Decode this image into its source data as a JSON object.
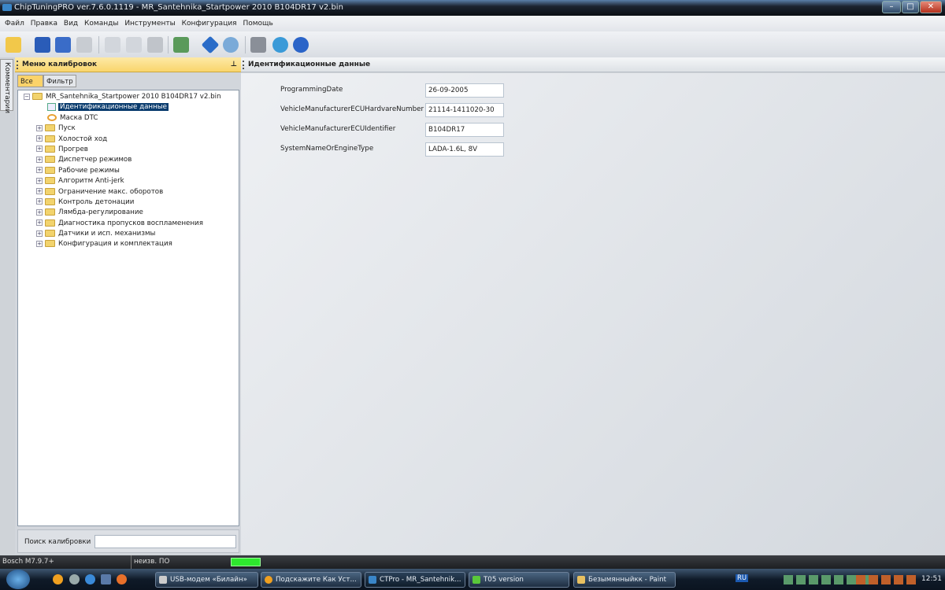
{
  "window": {
    "title": "ChipTuningPRO ver.7.6.0.1119 - MR_Santehnika_Startpower 2010 B104DR17 v2.bin",
    "min": "–",
    "max": "□",
    "close": "✕"
  },
  "menu": [
    "Файл",
    "Правка",
    "Вид",
    "Команды",
    "Инструменты",
    "Конфигурация",
    "Помощь"
  ],
  "side_tab": "Комментарии",
  "left_panel": {
    "title": "Меню калибровок",
    "pin": "ᵖ",
    "tabs": [
      "Все",
      "Фильтр"
    ],
    "root": "MR_Santehnika_Startpower 2010 B104DR17 v2.bin",
    "leaf_items": [
      "Идентификационные данные",
      "Маска DTC"
    ],
    "folders": [
      "Пуск",
      "Холостой ход",
      "Прогрев",
      "Диспетчер режимов",
      "Рабочие режимы",
      "Алгоритм Anti-jerk",
      "Ограничение макс. оборотов",
      "Контроль детонации",
      "Лямбда-регулирование",
      "Диагностика пропусков воспламенения",
      "Датчики и исп. механизмы",
      "Конфигурация и комплектация"
    ],
    "search_label": "Поиск калибровки",
    "search_value": ""
  },
  "right_panel": {
    "title": "Идентификационные данные",
    "fields": [
      {
        "label": "ProgrammingDate",
        "value": "26-09-2005"
      },
      {
        "label": "VehicleManufacturerECUHardvareNumber",
        "value": "21114-1411020-30"
      },
      {
        "label": "VehicleManufacturerECUIdentifier",
        "value": "B104DR17"
      },
      {
        "label": "SystemNameOrEngineType",
        "value": "LADA-1.6L, 8V"
      }
    ]
  },
  "status": {
    "ecu": "Bosch M7.9.7+",
    "software": "неизв. ПО",
    "indicator_color": "#2ee82e"
  },
  "taskbar": {
    "tasks": [
      "USB-модем «Билайн»",
      "Подскажите Как Уст...",
      "CTPro - MR_Santehnik...",
      "T05 version",
      "Безымянныйкк - Paint"
    ],
    "lang": "RU",
    "clock": "12:51"
  }
}
